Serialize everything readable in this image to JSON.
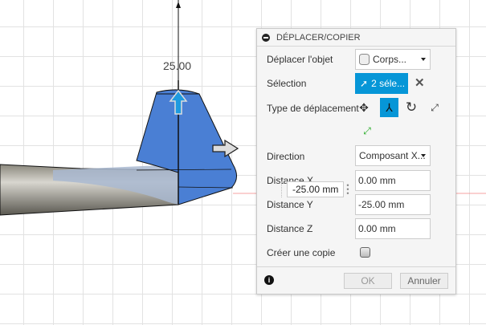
{
  "viewport": {
    "dimension_label": "25.00",
    "floating_input_value": "-25.00 mm"
  },
  "panel": {
    "title": "DÉPLACER/COPIER",
    "move_object_label": "Déplacer l'objet",
    "move_object_value": "Corps...",
    "selection_label": "Sélection",
    "selection_value": "2 séle...",
    "move_type_label": "Type de déplacement",
    "move_types": [
      "free-move",
      "translate",
      "rotate",
      "point-to-point",
      "point-to-position"
    ],
    "direction_label": "Direction",
    "direction_value": "Composant X...",
    "distance_x_label": "Distance X",
    "distance_x_value": "0.00 mm",
    "distance_y_label": "Distance Y",
    "distance_y_value": "-25.00 mm",
    "distance_z_label": "Distance Z",
    "distance_z_value": "0.00 mm",
    "copy_label": "Créer une copie",
    "copy_checked": false,
    "ok_label": "OK",
    "cancel_label": "Annuler"
  },
  "colors": {
    "accent": "#0696d7",
    "body_blue": "#4a7fd4"
  }
}
